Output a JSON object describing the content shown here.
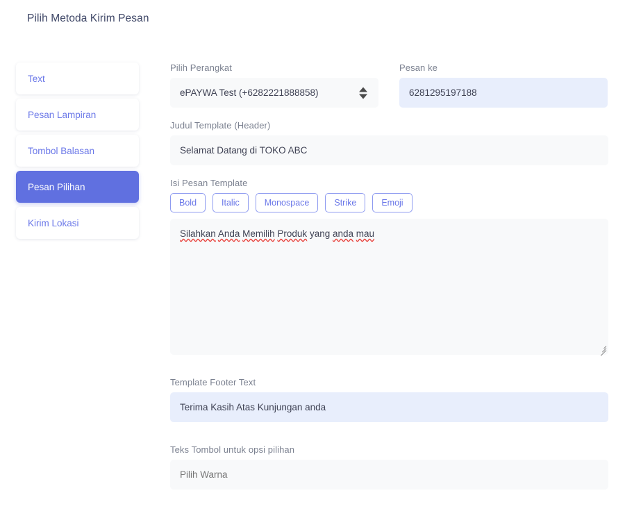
{
  "page": {
    "title": "Pilih Metoda Kirim Pesan"
  },
  "sidebar": {
    "items": [
      {
        "label": "Text",
        "active": false
      },
      {
        "label": "Pesan Lampiran",
        "active": false
      },
      {
        "label": "Tombol Balasan",
        "active": false
      },
      {
        "label": "Pesan Pilihan",
        "active": true
      },
      {
        "label": "Kirim Lokasi",
        "active": false
      }
    ]
  },
  "form": {
    "device": {
      "label": "Pilih Perangkat",
      "value": "ePAYWA Test (+6282221888858)",
      "icon": "select-updown-arrows-icon"
    },
    "recipient": {
      "label": "Pesan ke",
      "value": "6281295197188",
      "placeholder": "Pesan ke"
    },
    "header": {
      "label": "Judul Template (Header)",
      "value": "Selamat Datang di TOKO ABC",
      "placeholder": "Judul Template (Header)"
    },
    "body": {
      "label": "Isi Pesan Template",
      "value": "Silahkan Anda Memilih Produk yang anda mau",
      "placeholder": "Isi Pesan Template",
      "spellcheck_words": [
        "Silahkan",
        "Anda",
        "Memilih",
        "Produk",
        "anda",
        "mau"
      ],
      "format_buttons": [
        {
          "label": "Bold"
        },
        {
          "label": "Italic"
        },
        {
          "label": "Monospace"
        },
        {
          "label": "Strike"
        },
        {
          "label": "Emoji"
        }
      ]
    },
    "footer": {
      "label": "Template Footer Text",
      "value": "Terima Kasih Atas Kunjungan anda",
      "placeholder": "Template Footer Text"
    },
    "button_text": {
      "label": "Teks Tombol untuk opsi pilihan",
      "value": "",
      "placeholder": "Pilih Warna"
    }
  },
  "colors": {
    "accent": "#6070e0",
    "link": "#6a77e8",
    "autofill_bg": "#e8eefc",
    "field_bg": "#f8f9fa",
    "label": "#7b8190",
    "title": "#3f4767",
    "spellcheck": "#e8403a"
  }
}
